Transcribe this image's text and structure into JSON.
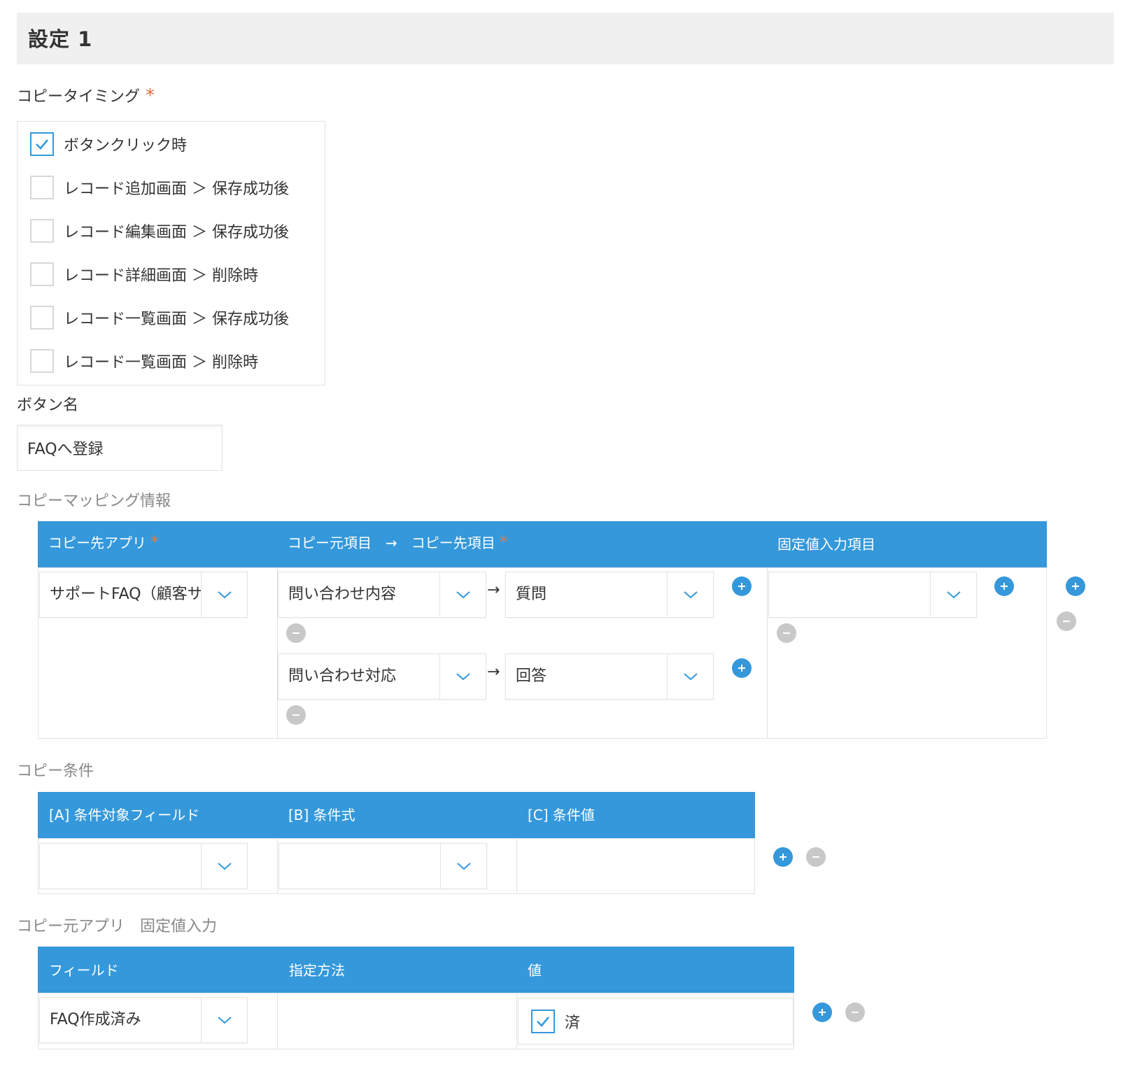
{
  "setting": {
    "title": "設定 1"
  },
  "timing": {
    "label": "コピータイミング",
    "required": "*",
    "options": [
      {
        "label": "ボタンクリック時",
        "checked": true
      },
      {
        "label": "レコード追加画面 ＞ 保存成功後",
        "checked": false
      },
      {
        "label": "レコード編集画面 ＞ 保存成功後",
        "checked": false
      },
      {
        "label": "レコード詳細画面 ＞ 削除時",
        "checked": false
      },
      {
        "label": "レコード一覧画面 ＞ 保存成功後",
        "checked": false
      },
      {
        "label": "レコード一覧画面 ＞ 削除時",
        "checked": false
      }
    ]
  },
  "button_name": {
    "label": "ボタン名",
    "value": "FAQへ登録"
  },
  "mapping": {
    "section_label": "コピーマッピング情報",
    "headers": {
      "dest_app": "コピー先アプリ",
      "fields": "コピー元項目　→　コピー先項目",
      "fixed": "固定値入力項目",
      "required": "*"
    },
    "dest_app_value": "サポートFAQ（顧客サ",
    "arrow": "→",
    "rows": [
      {
        "source": "問い合わせ内容",
        "dest": "質問"
      },
      {
        "source": "問い合わせ対応",
        "dest": "回答"
      }
    ],
    "fixed_value": ""
  },
  "condition": {
    "section_label": "コピー条件",
    "headers": {
      "a": "[A] 条件対象フィールド",
      "b": "[B] 条件式",
      "c": "[C] 条件値"
    },
    "a_value": "",
    "b_value": ""
  },
  "source_fixed": {
    "section_label": "コピー元アプリ　固定値入力",
    "headers": {
      "field": "フィールド",
      "method": "指定方法",
      "value": "値"
    },
    "field_value": "FAQ作成済み",
    "value_option": {
      "label": "済",
      "checked": true
    }
  },
  "colors": {
    "accent": "#3498db",
    "required": "#e0713d",
    "remove": "#c8c8c8"
  },
  "icons": {
    "add": "plus-circle-icon",
    "remove": "minus-circle-icon",
    "dropdown": "chevron-down-icon",
    "check": "check-icon"
  }
}
